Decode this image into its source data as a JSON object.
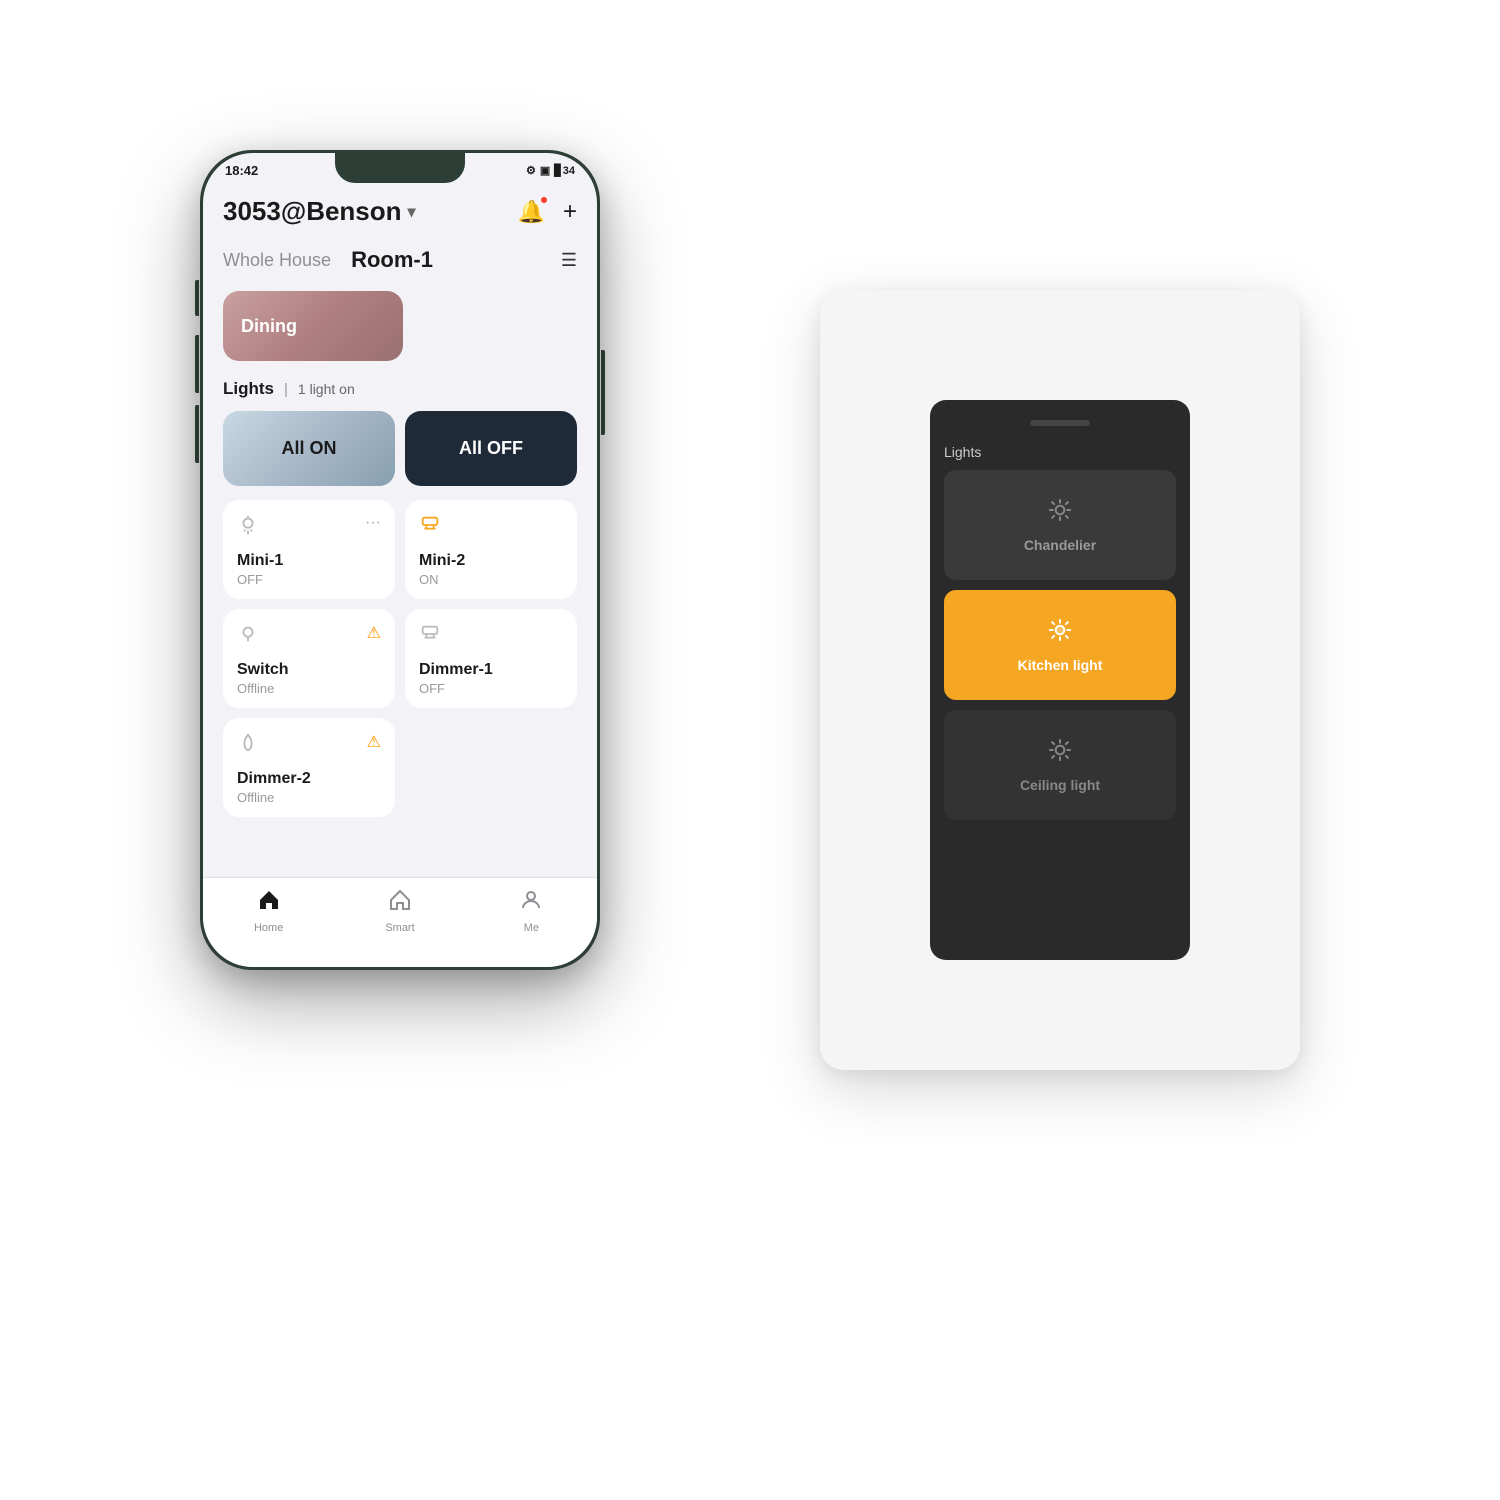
{
  "phone": {
    "status_bar": {
      "time": "18:42",
      "right_icons": "▣ ◉ 4G ▊ 34"
    },
    "header": {
      "title": "3053@Benson",
      "title_arrow": "▾",
      "bell_icon": "bell",
      "plus_icon": "+"
    },
    "room_tabs": {
      "inactive": "Whole House",
      "active": "Room-1",
      "menu_icon": "☰"
    },
    "dining_card": {
      "label": "Dining"
    },
    "lights_section": {
      "title": "Lights",
      "divider": "|",
      "status": "1 light on"
    },
    "scene_buttons": {
      "all_on": "All ON",
      "all_off": "All OFF"
    },
    "devices": [
      {
        "name": "Mini-1",
        "sub": "OFF",
        "icon": "💡",
        "active": false,
        "badge": "···"
      },
      {
        "name": "Mini-2",
        "sub": "ON",
        "icon": "🔆",
        "active": true,
        "badge": ""
      },
      {
        "name": "Switch",
        "sub": "Offline",
        "icon": "💡",
        "active": false,
        "badge": "⚠"
      },
      {
        "name": "Dimmer-1",
        "sub": "OFF",
        "icon": "🔆",
        "active": false,
        "badge": ""
      },
      {
        "name": "Dimmer-2",
        "sub": "Offline",
        "icon": "💡",
        "active": false,
        "badge": "⚠"
      }
    ],
    "bottom_nav": [
      {
        "label": "Home",
        "active": false,
        "icon": "⌂"
      },
      {
        "label": "Smart",
        "active": false,
        "icon": "⌂"
      },
      {
        "label": "Me",
        "active": false,
        "icon": "⌂"
      }
    ]
  },
  "wall_switch": {
    "section_label": "Lights",
    "buttons": [
      {
        "label": "Chandelier",
        "state": "off"
      },
      {
        "label": "Kitchen light",
        "state": "on"
      },
      {
        "label": "Ceiling light",
        "state": "dim"
      }
    ]
  }
}
